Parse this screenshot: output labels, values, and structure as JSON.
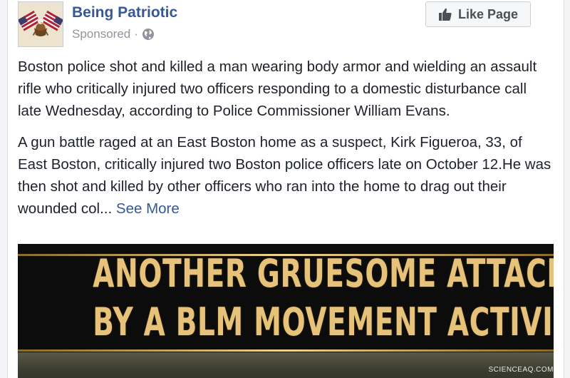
{
  "page": {
    "name": "Being Patriotic",
    "sponsored": "Sponsored",
    "separator": "·"
  },
  "like_button": {
    "label": "Like Page"
  },
  "post": {
    "paragraph1": "Boston police shot and killed a man wearing body armor and wielding an assault rifle who critically injured two officers responding to a domestic disturbance call late Wednesday, according to Police Commissioner William Evans.",
    "paragraph2": "A gun battle raged at an East Boston home as a suspect, Kirk Figueroa, 33, of East Boston, critically injured two Boston police officers late on October 12.He was then shot and killed by other officers who ran into the home to drag out their wounded col...",
    "see_more": "See More"
  },
  "media": {
    "headline_line1": "ANOTHER GRUESOME ATTACK ON POLICE",
    "headline_line2": "BY A BLM MOVEMENT ACTIVIST"
  },
  "watermark": "SCIENCEAQ.COM",
  "colors": {
    "link_blue": "#365899",
    "text": "#1d2129",
    "meta_gray": "#90949c",
    "headline_gold": "#e6c27a"
  },
  "icons": {
    "avatar": "flags-eagle-avatar",
    "audience": "globe-icon",
    "like": "thumbs-up-icon"
  }
}
